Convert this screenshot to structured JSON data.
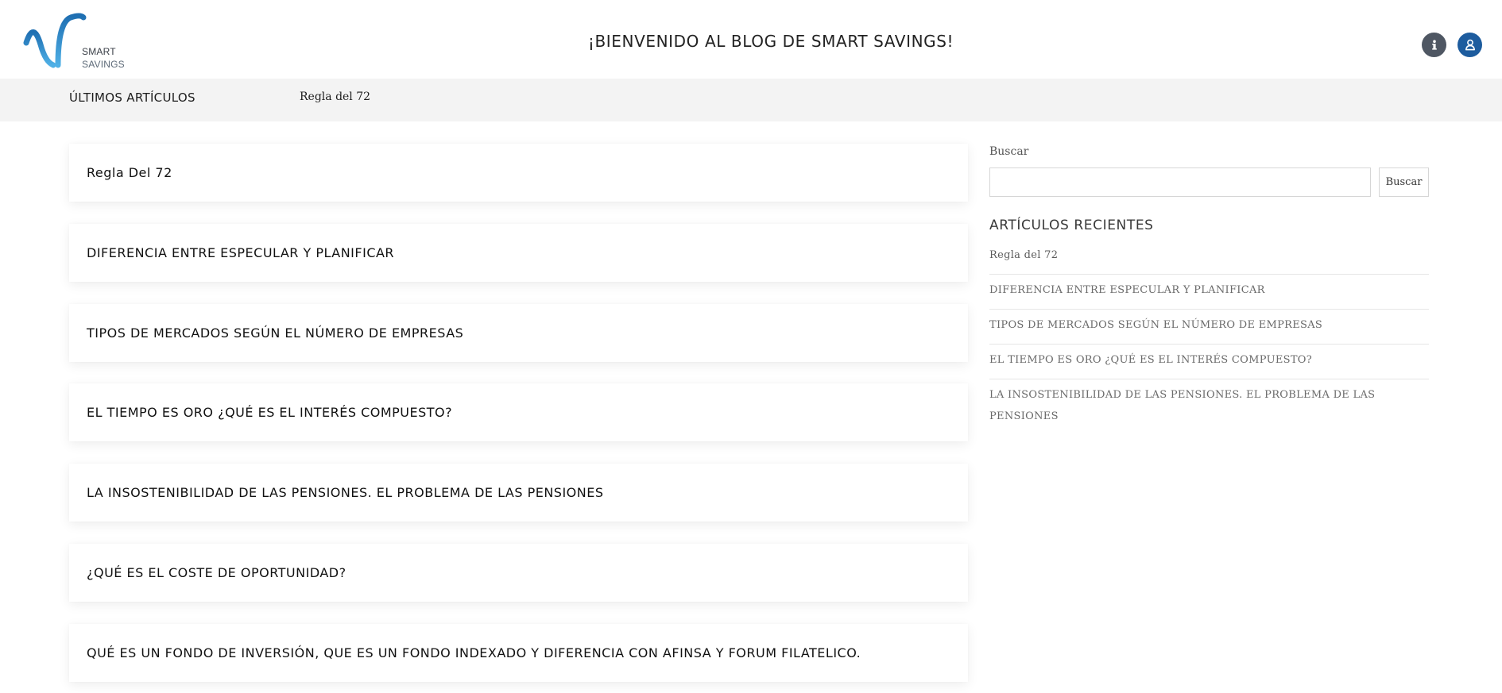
{
  "header": {
    "logo": {
      "line1": "SMART",
      "line2": "SAVINGS",
      "gradient_colors": [
        "#1f6fb2",
        "#4fb0e6"
      ]
    },
    "title": "¡BIENVENIDO AL BLOG DE SMART SAVINGS!",
    "info_button": {
      "icon": "info-icon",
      "color": "#4f5763"
    },
    "user_button": {
      "icon": "user-icon",
      "color": "#1d5c9e"
    }
  },
  "nav": {
    "label": "ÚLTIMOS ARTÍCULOS",
    "ticker": "Regla del 72"
  },
  "articles": [
    {
      "title": "Regla Del 72"
    },
    {
      "title": "DIFERENCIA ENTRE ESPECULAR Y PLANIFICAR"
    },
    {
      "title": "TIPOS DE MERCADOS SEGÚN EL NÚMERO DE EMPRESAS"
    },
    {
      "title": "EL TIEMPO ES ORO ¿QUÉ ES EL INTERÉS COMPUESTO?"
    },
    {
      "title": "LA INSOSTENIBILIDAD DE LAS PENSIONES.  EL PROBLEMA DE LAS PENSIONES"
    },
    {
      "title": "¿QUÉ ES EL COSTE DE OPORTUNIDAD?"
    },
    {
      "title": "QUÉ ES UN FONDO DE INVERSIÓN, QUE ES UN FONDO INDEXADO Y DIFERENCIA CON AFINSA Y FORUM FILATELICO."
    }
  ],
  "sidebar": {
    "search": {
      "label": "Buscar",
      "value": "",
      "placeholder": "",
      "button_label": "Buscar"
    },
    "recent": {
      "title": "ARTÍCULOS RECIENTES",
      "items": [
        "Regla del 72",
        "DIFERENCIA ENTRE ESPECULAR Y PLANIFICAR",
        "TIPOS DE MERCADOS SEGÚN EL NÚMERO DE EMPRESAS",
        "EL TIEMPO ES ORO ¿QUÉ ES EL INTERÉS COMPUESTO?",
        "LA INSOSTENIBILIDAD DE LAS PENSIONES.  EL PROBLEMA DE LAS PENSIONES"
      ]
    }
  }
}
